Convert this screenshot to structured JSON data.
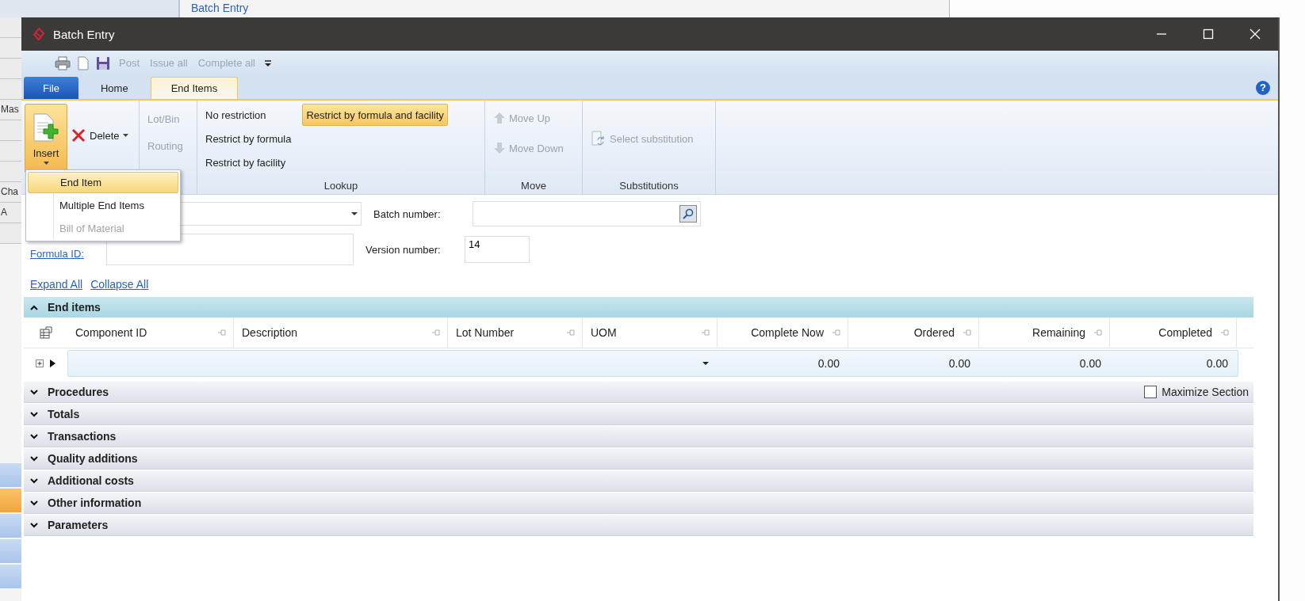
{
  "background_window": {
    "title": "Batch Entry",
    "side_labels": [
      "Mas",
      "Cha",
      "A"
    ]
  },
  "window": {
    "title": "Batch Entry"
  },
  "quick_access": [
    {
      "label": "Post",
      "disabled": true
    },
    {
      "label": "Issue all",
      "disabled": true
    },
    {
      "label": "Complete all",
      "disabled": true
    }
  ],
  "help": "?",
  "ribbon_tabs": [
    {
      "label": "File",
      "kind": "file",
      "selected": false
    },
    {
      "label": "Home",
      "kind": "tab",
      "selected": false
    },
    {
      "label": "End Items",
      "kind": "tab",
      "selected": true
    }
  ],
  "ribbon": {
    "insert": {
      "label": "Insert",
      "pressed": true
    },
    "delete": {
      "label": "Delete"
    },
    "lot_group": [
      {
        "label": "Lot/Bin",
        "disabled": true
      },
      {
        "label": "Routing",
        "disabled": true
      }
    ],
    "lookup": {
      "label": "Lookup",
      "options": [
        {
          "label": "No restriction",
          "selected": false
        },
        {
          "label": "Restrict by formula",
          "selected": false
        },
        {
          "label": "Restrict by facility",
          "selected": false
        },
        {
          "label": "Restrict by formula and facility",
          "selected": true
        }
      ]
    },
    "move": {
      "label": "Move",
      "items": [
        {
          "label": "Move Up",
          "kind": "up",
          "disabled": true
        },
        {
          "label": "Move Down",
          "kind": "down",
          "disabled": true
        }
      ]
    },
    "substitutions": {
      "label": "Substitutions",
      "item": {
        "label": "Select substitution",
        "disabled": true
      }
    }
  },
  "insert_menu": [
    {
      "label": "End Item",
      "selected": true,
      "disabled": false
    },
    {
      "label": "Multiple End Items",
      "selected": false,
      "disabled": false
    },
    {
      "label": "Bill of Material",
      "selected": false,
      "disabled": true
    }
  ],
  "form": {
    "formula_id_label": "Formula ID:",
    "batch_number_label": "Batch number:",
    "version_number_label": "Version number:",
    "version_number": "14"
  },
  "links": [
    "Expand All",
    "Collapse All"
  ],
  "end_items": {
    "title": "End items",
    "expanded": true,
    "columns": [
      {
        "label": "Component ID",
        "kind": "text"
      },
      {
        "label": "Description",
        "kind": "text"
      },
      {
        "label": "Lot Number",
        "kind": "text"
      },
      {
        "label": "UOM",
        "kind": "select"
      },
      {
        "label": "Complete Now",
        "kind": "number"
      },
      {
        "label": "Ordered",
        "kind": "number"
      },
      {
        "label": "Remaining",
        "kind": "number"
      },
      {
        "label": "Completed",
        "kind": "number"
      }
    ],
    "rows": [
      {
        "complete_now": "0.00",
        "ordered": "0.00",
        "remaining": "0.00",
        "completed": "0.00"
      }
    ]
  },
  "sections": [
    {
      "title": "Procedures",
      "expanded": false,
      "maximize": {
        "label": "Maximize Section",
        "checked": false
      }
    },
    {
      "title": "Totals",
      "expanded": false
    },
    {
      "title": "Transactions",
      "expanded": false
    },
    {
      "title": "Quality additions",
      "expanded": false
    },
    {
      "title": "Additional costs",
      "expanded": false
    },
    {
      "title": "Other information",
      "expanded": false
    },
    {
      "title": "Parameters",
      "expanded": false
    }
  ]
}
